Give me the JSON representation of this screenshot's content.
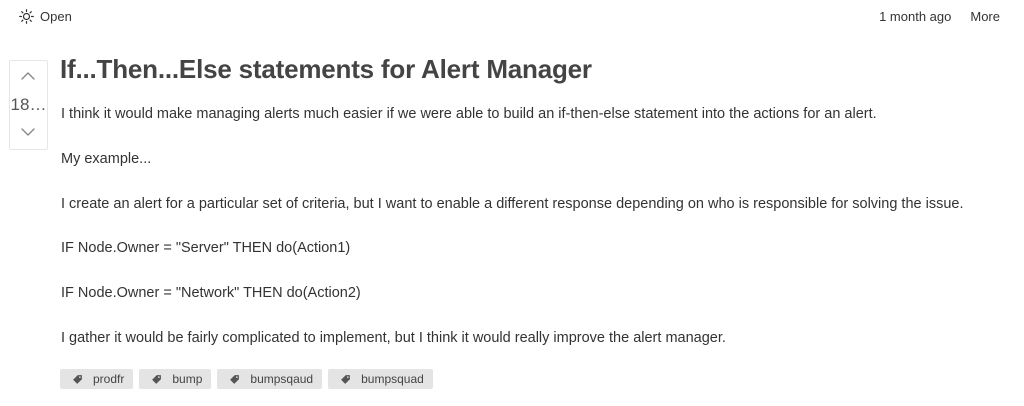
{
  "header": {
    "status_icon": "sun-icon",
    "status_label": "Open",
    "time": "1 month ago",
    "more_label": "More"
  },
  "vote": {
    "count": "18…"
  },
  "post": {
    "title": "If...Then...Else statements for Alert Manager",
    "paragraphs": [
      "I think it would make managing alerts much easier if we were able to build an if-then-else statement into the actions for an alert.",
      "My example...",
      "I create an alert for a particular set of criteria, but I want to enable a different response depending on who is responsible for solving the issue.",
      "IF Node.Owner = \"Server\" THEN do(Action1)",
      "IF Node.Owner = \"Network\" THEN do(Action2)",
      "I gather it would be fairly complicated to implement, but I think it would really improve the alert manager."
    ]
  },
  "tags": [
    {
      "label": "prodfr",
      "icon": "tag-icon"
    },
    {
      "label": "bump",
      "icon": "tag-icon"
    },
    {
      "label": "bumpsqaud",
      "icon": "tag-icon"
    },
    {
      "label": "bumpsquad",
      "icon": "tag-icon"
    }
  ]
}
